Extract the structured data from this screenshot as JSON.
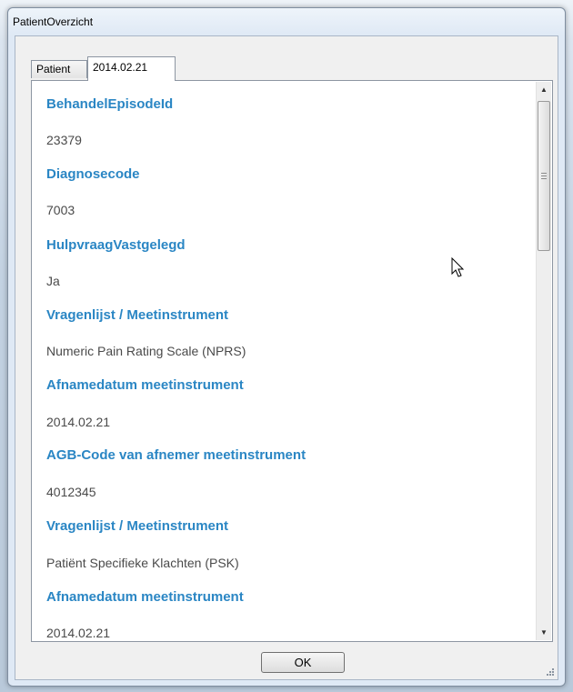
{
  "window": {
    "title": "PatientOverzicht"
  },
  "tabs": [
    {
      "label": "Patient",
      "active": false
    },
    {
      "label": "2014.02.21",
      "active": true
    }
  ],
  "fields": [
    {
      "label": "BehandelEpisodeId",
      "value": "23379"
    },
    {
      "label": "Diagnosecode",
      "value": "7003"
    },
    {
      "label": "HulpvraagVastgelegd",
      "value": "Ja"
    },
    {
      "label": "Vragenlijst / Meetinstrument",
      "value": "Numeric Pain Rating Scale (NPRS)"
    },
    {
      "label": "Afnamedatum meetinstrument",
      "value": "2014.02.21"
    },
    {
      "label": "AGB-Code van afnemer meetinstrument",
      "value": "4012345"
    },
    {
      "label": "Vragenlijst / Meetinstrument",
      "value": "Patiënt Specifieke Klachten (PSK)"
    },
    {
      "label": "Afnamedatum meetinstrument",
      "value": "2014.02.21"
    }
  ],
  "buttons": {
    "ok_label": "OK"
  },
  "icons": {
    "scroll_up": "scroll-up-arrow-icon",
    "scroll_down": "scroll-down-arrow-icon",
    "cursor": "mouse-pointer-icon",
    "resize": "resize-grip-icon"
  },
  "colors": {
    "label": "#2a86c4",
    "value": "#4a4a4a",
    "window_frame": "#dfe9f5"
  }
}
